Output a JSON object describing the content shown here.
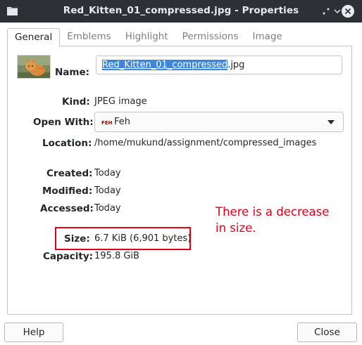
{
  "window": {
    "title": "Red_Kitten_01_compressed.jpg - Properties"
  },
  "tabs": [
    {
      "label": "General",
      "active": true
    },
    {
      "label": "Emblems",
      "active": false
    },
    {
      "label": "Highlight",
      "active": false
    },
    {
      "label": "Permissions",
      "active": false
    },
    {
      "label": "Image",
      "active": false
    }
  ],
  "general": {
    "name_label": "Name:",
    "name_selected": "Red_Kitten_01_compressed",
    "name_extension": ".jpg",
    "kind_label": "Kind:",
    "kind_value": "JPEG image",
    "open_with_label": "Open With:",
    "open_with_value": "Feh",
    "open_with_icon": "feh-app-icon",
    "location_label": "Location:",
    "location_value": "/home/mukund/assignment/compressed_images",
    "created_label": "Created:",
    "created_value": "Today",
    "modified_label": "Modified:",
    "modified_value": "Today",
    "accessed_label": "Accessed:",
    "accessed_value": "Today",
    "size_label": "Size:",
    "size_value": "6.7 KiB (6,901 bytes)",
    "capacity_label": "Capacity:",
    "capacity_value": "195.8 GiB"
  },
  "annotation": {
    "text_line1": "There is a decrease",
    "text_line2": "in size.",
    "color": "#e3001b"
  },
  "buttons": {
    "help_label": "Help",
    "close_label": "Close"
  },
  "colors": {
    "titlebar": "#2d3135",
    "selection": "#3d86d9",
    "annotation_red": "#e3001b"
  }
}
